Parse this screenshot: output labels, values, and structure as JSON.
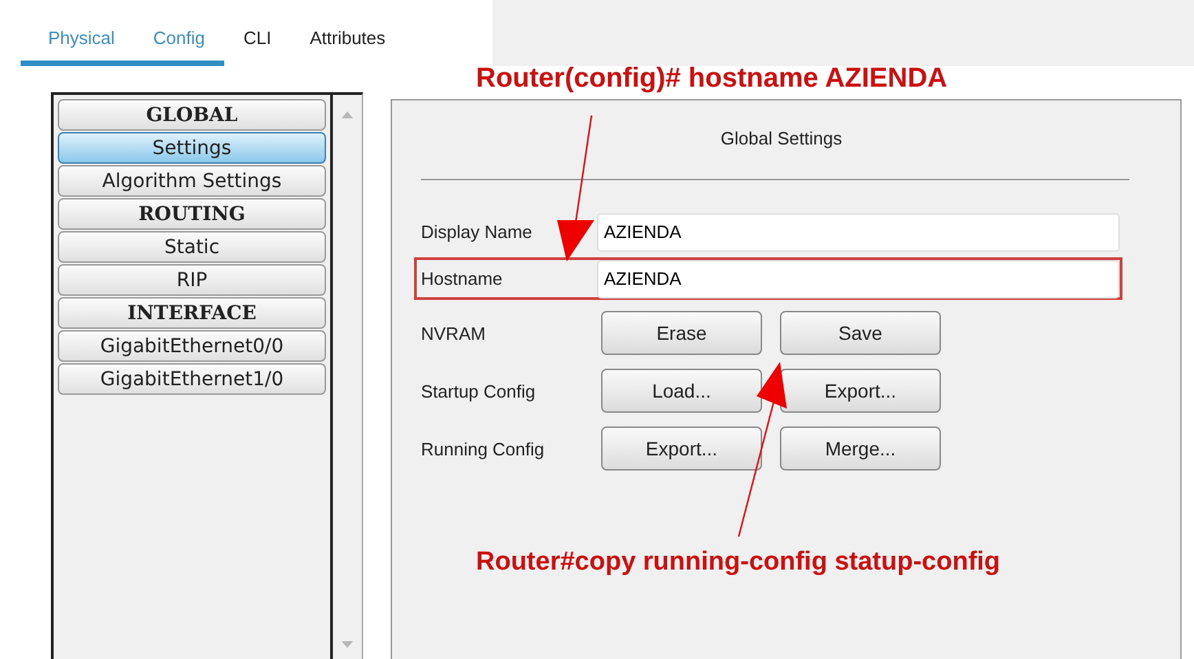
{
  "tabs": [
    {
      "label": "Physical",
      "highlighted": true
    },
    {
      "label": "Config",
      "highlighted": true
    },
    {
      "label": "CLI",
      "highlighted": false
    },
    {
      "label": "Attributes",
      "highlighted": false
    }
  ],
  "sidebar": {
    "items": [
      {
        "label": "GLOBAL",
        "kind": "header",
        "selected": false
      },
      {
        "label": "Settings",
        "kind": "item",
        "selected": true
      },
      {
        "label": "Algorithm Settings",
        "kind": "item",
        "selected": false
      },
      {
        "label": "ROUTING",
        "kind": "header",
        "selected": false
      },
      {
        "label": "Static",
        "kind": "item",
        "selected": false
      },
      {
        "label": "RIP",
        "kind": "item",
        "selected": false
      },
      {
        "label": "INTERFACE",
        "kind": "header",
        "selected": false
      },
      {
        "label": "GigabitEthernet0/0",
        "kind": "item",
        "selected": false
      },
      {
        "label": "GigabitEthernet1/0",
        "kind": "item",
        "selected": false
      }
    ]
  },
  "panel": {
    "title": "Global Settings",
    "fields": [
      {
        "label": "Display Name",
        "value": "AZIENDA",
        "highlighted": false
      },
      {
        "label": "Hostname",
        "value": "AZIENDA",
        "highlighted": true
      }
    ],
    "button_rows": [
      {
        "label": "NVRAM",
        "buttons": [
          "Erase",
          "Save"
        ]
      },
      {
        "label": "Startup Config",
        "buttons": [
          "Load...",
          "Export..."
        ]
      },
      {
        "label": "Running Config",
        "buttons": [
          "Export...",
          "Merge..."
        ]
      }
    ]
  },
  "annotations": [
    "Router(config)# hostname AZIENDA",
    "Router#copy running-config statup-config"
  ]
}
